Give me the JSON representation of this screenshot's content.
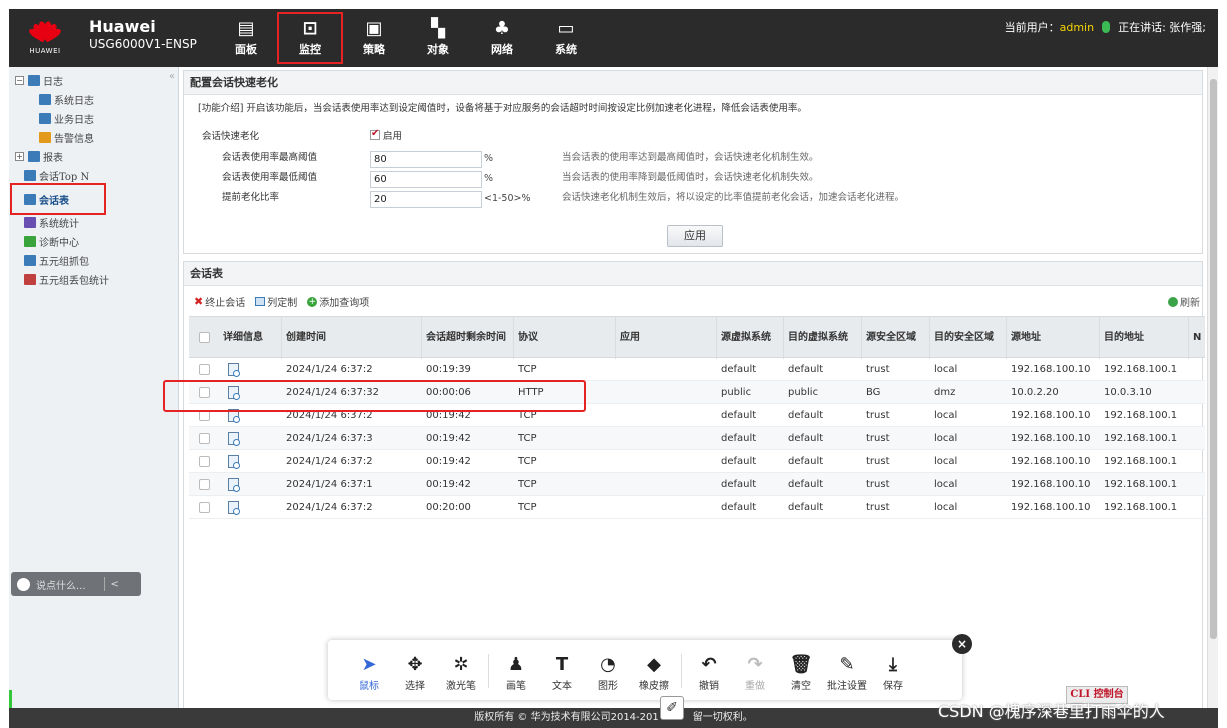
{
  "header": {
    "brand_title": "Huawei",
    "brand_sub": "USG6000V1-ENSP",
    "brand_word": "HUAWEI",
    "nav": [
      {
        "label": "面板",
        "icon": "dashboard-icon"
      },
      {
        "label": "监控",
        "icon": "monitor-icon",
        "active": true
      },
      {
        "label": "策略",
        "icon": "policy-icon"
      },
      {
        "label": "对象",
        "icon": "object-icon"
      },
      {
        "label": "网络",
        "icon": "network-icon"
      },
      {
        "label": "系统",
        "icon": "system-icon"
      }
    ],
    "current_user_label": "当前用户：",
    "current_user": "admin",
    "speaking": "正在讲话: 张作强;"
  },
  "sidebar": {
    "items": [
      {
        "label": "日志",
        "level": 0,
        "toggle": "−"
      },
      {
        "label": "系统日志",
        "level": 2
      },
      {
        "label": "业务日志",
        "level": 2
      },
      {
        "label": "告警信息",
        "level": 2
      },
      {
        "label": "报表",
        "level": 0,
        "toggle": "+"
      },
      {
        "label": "会话Top N",
        "level": 1
      },
      {
        "label": "会话表",
        "level": 1,
        "selected": true
      },
      {
        "label": "系统统计",
        "level": 1
      },
      {
        "label": "诊断中心",
        "level": 1
      },
      {
        "label": "五元组抓包",
        "level": 1
      },
      {
        "label": "五元组丢包统计",
        "level": 1
      }
    ],
    "chat_placeholder": "说点什么...",
    "chat_arrow": "<"
  },
  "config_panel": {
    "title": "配置会话快速老化",
    "intro": "[功能介绍] 开启该功能后，当会话表使用率达到设定阈值时，设备将基于对应服务的会话超时时间按设定比例加速老化进程，降低会话表使用率。",
    "fast_aging_label": "会话快速老化",
    "enable_label": "启用",
    "rows": [
      {
        "label": "会话表使用率最高阈值",
        "value": "80",
        "unit": "%",
        "hint": "当会话表的使用率达到最高阈值时，会话快速老化机制生效。"
      },
      {
        "label": "会话表使用率最低阈值",
        "value": "60",
        "unit": "%",
        "hint": "当会话表的使用率降到最低阈值时，会话快速老化机制失效。"
      },
      {
        "label": "提前老化比率",
        "value": "20",
        "unit": "<1-50>%",
        "hint": "会话快速老化机制生效后，将以设定的比率值提前老化会话，加速会话老化进程。"
      }
    ],
    "apply": "应用"
  },
  "session_panel": {
    "title": "会话表",
    "toolbar": {
      "terminate": "终止会话",
      "customize": "列定制",
      "add_query": "添加查询项",
      "refresh": "刷新"
    },
    "columns": [
      "详细信息",
      "创建时间",
      "会话超时剩余时间",
      "协议",
      "应用",
      "源虚拟系统",
      "目的虚拟系统",
      "源安全区域",
      "目的安全区域",
      "源地址",
      "目的地址",
      "N"
    ],
    "rows": [
      [
        "2024/1/24 6:37:2",
        "00:19:39",
        "TCP",
        "",
        "default",
        "default",
        "trust",
        "local",
        "192.168.100.10",
        "192.168.100.1"
      ],
      [
        "2024/1/24 6:37:32",
        "00:00:06",
        "HTTP",
        "",
        "public",
        "public",
        "BG",
        "dmz",
        "10.0.2.20",
        "10.0.3.10"
      ],
      [
        "2024/1/24 6:37:2",
        "00:19:42",
        "TCP",
        "",
        "default",
        "default",
        "trust",
        "local",
        "192.168.100.10",
        "192.168.100.1"
      ],
      [
        "2024/1/24 6:37:3",
        "00:19:42",
        "TCP",
        "",
        "default",
        "default",
        "trust",
        "local",
        "192.168.100.10",
        "192.168.100.1"
      ],
      [
        "2024/1/24 6:37:2",
        "00:19:42",
        "TCP",
        "",
        "default",
        "default",
        "trust",
        "local",
        "192.168.100.10",
        "192.168.100.1"
      ],
      [
        "2024/1/24 6:37:1",
        "00:19:42",
        "TCP",
        "",
        "default",
        "default",
        "trust",
        "local",
        "192.168.100.10",
        "192.168.100.1"
      ],
      [
        "2024/1/24 6:37:2",
        "00:20:00",
        "TCP",
        "",
        "default",
        "default",
        "trust",
        "local",
        "192.168.100.10",
        "192.168.100.1"
      ]
    ]
  },
  "annotation_toolbar": {
    "items": [
      {
        "label": "鼠标",
        "glyph": "➤",
        "active": true
      },
      {
        "label": "选择",
        "glyph": "✥"
      },
      {
        "label": "激光笔",
        "glyph": "✲"
      },
      {
        "label": "画笔",
        "glyph": "♟"
      },
      {
        "label": "文本",
        "glyph": "T"
      },
      {
        "label": "图形",
        "glyph": "◔"
      },
      {
        "label": "橡皮擦",
        "glyph": "◆"
      },
      {
        "label": "撤销",
        "glyph": "↶"
      },
      {
        "label": "重做",
        "glyph": "↷",
        "disabled": true
      },
      {
        "label": "清空",
        "glyph": "🗑"
      },
      {
        "label": "批注设置",
        "glyph": "✎"
      },
      {
        "label": "保存",
        "glyph": "⤓"
      }
    ],
    "close": "×"
  },
  "footer": {
    "copyright": "版权所有 © 华为技术有限公司2014-201",
    "copyright_tail": "留一切权利。",
    "cli": "CLI 控制台",
    "watermark": "CSDN @槐序深巷里打雨伞的人"
  },
  "colors": {
    "accent_red": "#e52323",
    "admin_yellow": "#f5d400",
    "header_bg": "#2b2b2b"
  }
}
